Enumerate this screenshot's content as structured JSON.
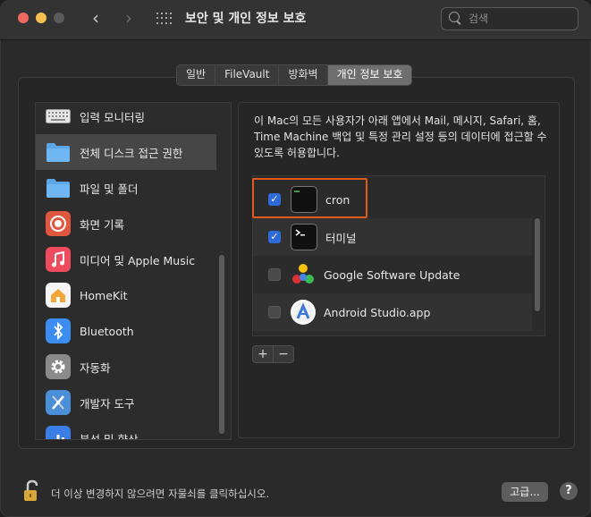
{
  "window": {
    "title": "보안 및 개인 정보 보호",
    "search_placeholder": "검색"
  },
  "tabs": [
    {
      "label": "일반",
      "active": false
    },
    {
      "label": "FileVault",
      "active": false
    },
    {
      "label": "방화벽",
      "active": false
    },
    {
      "label": "개인 정보 보호",
      "active": true
    }
  ],
  "sidebar": {
    "items": [
      {
        "label": "입력 모니터링",
        "icon": "keyboard-icon"
      },
      {
        "label": "전체 디스크 접근 권한",
        "icon": "folder-icon",
        "selected": true
      },
      {
        "label": "파일 및 폴더",
        "icon": "folder-icon"
      },
      {
        "label": "화면 기록",
        "icon": "record-icon"
      },
      {
        "label": "미디어 및 Apple Music",
        "icon": "music-icon"
      },
      {
        "label": "HomeKit",
        "icon": "home-icon"
      },
      {
        "label": "Bluetooth",
        "icon": "bluetooth-icon"
      },
      {
        "label": "자동화",
        "icon": "gear-icon"
      },
      {
        "label": "개발자 도구",
        "icon": "developer-tools-icon"
      },
      {
        "label": "분석 및 향상",
        "icon": "chart-icon"
      }
    ]
  },
  "main": {
    "description": "이 Mac의 모든 사용자가 아래 앱에서 Mail, 메시지, Safari, 홈, Time Machine 백업 및 특정 관리 설정 등의 데이터에 접근할 수 있도록 허용합니다.",
    "apps": [
      {
        "name": "cron",
        "checked": true,
        "icon": "terminal-icon"
      },
      {
        "name": "터미널",
        "checked": true,
        "icon": "terminal-icon"
      },
      {
        "name": "Google Software Update",
        "checked": false,
        "icon": "google-update-icon"
      },
      {
        "name": "Android Studio.app",
        "checked": false,
        "icon": "android-studio-icon"
      }
    ],
    "add_label": "+",
    "remove_label": "−"
  },
  "footer": {
    "lock_text": "더 이상 변경하지 않으려면 자물쇠를 클릭하십시오.",
    "advanced_label": "고급...",
    "help_label": "?"
  },
  "colors": {
    "accent": "#2e6bd9",
    "highlight": "#e25a1c"
  }
}
